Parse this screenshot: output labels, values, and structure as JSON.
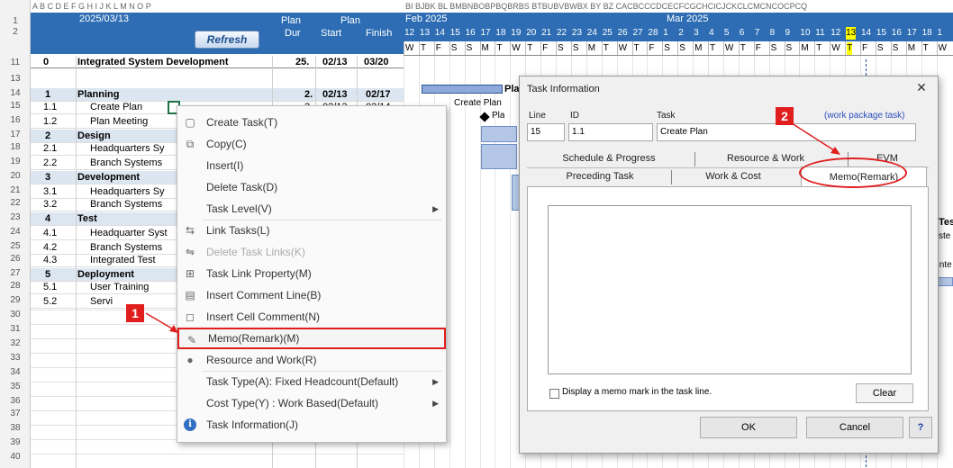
{
  "sheet": {
    "date": "2025/03/13",
    "refresh_label": "Refresh",
    "headers": {
      "plan_dur": "Plan",
      "dur": "Dur",
      "plan": "Plan",
      "start": "Start",
      "finish": "Finish"
    },
    "col_letters": "A B C D E F G H I J K L M N O P",
    "gantt_col_letters": "BI BJBK BL BMBNBOBPBQBRBS BTBUBVBWBX BY BZ CACBCCCDCECFCGCHCICJCKCLCMCNCOCPCQ",
    "month_feb": "Feb 2025",
    "month_mar": "Mar 2025",
    "days": [
      "12",
      "13",
      "14",
      "15",
      "16",
      "17",
      "18",
      "19",
      "20",
      "21",
      "22",
      "23",
      "24",
      "25",
      "26",
      "27",
      "28",
      "1",
      "2",
      "3",
      "4",
      "5",
      "6",
      "7",
      "8",
      "9",
      "10",
      "11",
      "12",
      "13",
      "14",
      "15",
      "16",
      "17",
      "18",
      "1"
    ],
    "weekdays": [
      "W",
      "T",
      "F",
      "S",
      "S",
      "M",
      "T",
      "W",
      "T",
      "F",
      "S",
      "S",
      "M",
      "T",
      "W",
      "T",
      "F",
      "S",
      "S",
      "M",
      "T",
      "W",
      "T",
      "F",
      "S",
      "S",
      "M",
      "T",
      "W",
      "T",
      "F",
      "S",
      "S",
      "M",
      "T",
      "W"
    ],
    "rownums": [
      "1",
      "2",
      "11",
      "13",
      "14",
      "15",
      "16",
      "17",
      "18",
      "19",
      "20",
      "21",
      "22",
      "23",
      "24",
      "25",
      "26",
      "27",
      "28",
      "29",
      "30",
      "31",
      "32",
      "33",
      "34",
      "35",
      "36",
      "37",
      "38",
      "39",
      "40"
    ],
    "project": {
      "num": "0",
      "name": "Integrated System Development",
      "dur": "25.",
      "start": "02/13",
      "finish": "03/20"
    },
    "tasks": [
      {
        "num": "1",
        "name": "Planning",
        "dur": "2.",
        "start": "02/13",
        "finish": "02/17",
        "phase": true
      },
      {
        "num": "1.1",
        "name": "Create Plan",
        "dur": "2",
        "start": "02/13",
        "finish": "02/14"
      },
      {
        "num": "1.2",
        "name": "Plan Meeting"
      },
      {
        "num": "2",
        "name": "Design",
        "phase": true
      },
      {
        "num": "2.1",
        "name": "Headquarters Sy"
      },
      {
        "num": "2.2",
        "name": "Branch Systems"
      },
      {
        "num": "3",
        "name": "Development",
        "phase": true
      },
      {
        "num": "3.1",
        "name": "Headquarters Sy"
      },
      {
        "num": "3.2",
        "name": "Branch Systems"
      },
      {
        "num": "4",
        "name": "Test",
        "phase": true
      },
      {
        "num": "4.1",
        "name": "Headquarter Syst"
      },
      {
        "num": "4.2",
        "name": "Branch Systems"
      },
      {
        "num": "4.3",
        "name": "Integrated Test"
      },
      {
        "num": "5",
        "name": "Deployment",
        "phase": true
      },
      {
        "num": "5.1",
        "name": "User Training"
      },
      {
        "num": "5.2",
        "name": "Servi"
      }
    ],
    "gantt_labels": {
      "pla": "Pla",
      "create_plan": "Create Plan",
      "pla2": "Pla",
      "te": "Tes",
      "ste": "ste",
      "inte": "Inte"
    }
  },
  "context_menu": {
    "items": [
      {
        "label": "Create Task(T)",
        "icon": "document-icon"
      },
      {
        "label": "Copy(C)",
        "icon": "copy-icon"
      },
      {
        "label": "Insert(I)"
      },
      {
        "label": "Delete Task(D)"
      },
      {
        "label": "Task Level(V)",
        "submenu": true
      },
      {
        "label": "Link Tasks(L)",
        "icon": "link-icon"
      },
      {
        "label": "Delete Task Links(K)",
        "icon": "unlink-icon",
        "disabled": true
      },
      {
        "label": "Task Link Property(M)",
        "icon": "link-property-icon"
      },
      {
        "label": "Insert Comment Line(B)",
        "icon": "comment-line-icon"
      },
      {
        "label": "Insert Cell Comment(N)",
        "icon": "cell-comment-icon"
      },
      {
        "label": "Memo(Remark)(M)",
        "icon": "memo-icon",
        "highlight": true
      },
      {
        "label": "Resource and Work(R)",
        "icon": "resource-icon"
      },
      {
        "label": "Task Type(A): Fixed Headcount(Default)",
        "submenu": true
      },
      {
        "label": "Cost Type(Y) : Work Based(Default)",
        "submenu": true
      },
      {
        "label": "Task Information(J)",
        "icon": "info-icon"
      }
    ]
  },
  "dialog": {
    "title": "Task Information",
    "close": "✕",
    "line_label": "Line",
    "id_label": "ID",
    "task_label": "Task",
    "wp_label": "(work package task)",
    "line_value": "15",
    "id_value": "1.1",
    "task_value": "Create Plan",
    "tabs_row1": [
      "Schedule & Progress",
      "Resource & Work",
      "EVM"
    ],
    "tabs_row2": [
      "Preceding Task",
      "Work & Cost",
      "Memo(Remark)"
    ],
    "memo_mark_label": "Display a memo mark in the task line.",
    "clear_label": "Clear",
    "ok_label": "OK",
    "cancel_label": "Cancel",
    "help_label": "?"
  },
  "callouts": {
    "one": "1",
    "two": "2"
  },
  "colors": {
    "accent_red": "#e01e1e",
    "header_blue": "#2e6db4",
    "phase_fill": "#dce6f1",
    "today_yellow": "#ffff00"
  }
}
